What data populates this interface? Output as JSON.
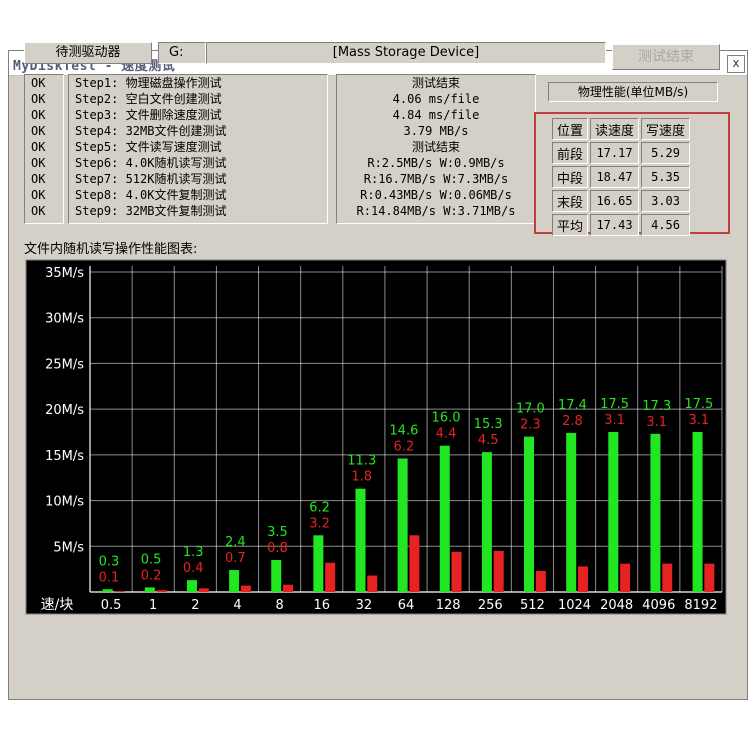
{
  "window": {
    "title": "MyDiskTest - 速度测试",
    "close_glyph": "x"
  },
  "drive": {
    "label": "待测驱动器",
    "letter": "G:",
    "name": "[Mass Storage Device]"
  },
  "done_button": "测试结束",
  "status": [
    "OK",
    "OK",
    "OK",
    "OK",
    "OK",
    "OK",
    "OK",
    "OK",
    "OK"
  ],
  "steps": [
    "Step1: 物理磁盘操作测试",
    "Step2: 空白文件创建测试",
    "Step3: 文件删除速度测试",
    "Step4: 32MB文件创建测试",
    "Step5: 文件读写速度测试",
    "Step6: 4.0K随机读写测试",
    "Step7: 512K随机读写测试",
    "Step8: 4.0K文件复制测试",
    "Step9: 32MB文件复制测试"
  ],
  "results": [
    "测试结束",
    "4.06 ms/file",
    "4.84 ms/file",
    "3.79 MB/s",
    "测试结束",
    "R:2.5MB/s W:0.9MB/s",
    "R:16.7MB/s W:7.3MB/s",
    "R:0.43MB/s W:0.06MB/s",
    "R:14.84MB/s W:3.71MB/s"
  ],
  "perf": {
    "title": "物理性能(单位MB/s)",
    "headers": [
      "位置",
      "读速度",
      "写速度"
    ],
    "rows": [
      [
        "前段",
        "17.17",
        "5.29"
      ],
      [
        "中段",
        "18.47",
        "5.35"
      ],
      [
        "末段",
        "16.65",
        "3.03"
      ],
      [
        "平均",
        "17.43",
        "4.56"
      ]
    ],
    "highlight_color": "#c04040"
  },
  "chart_title": "文件内随机读写操作性能图表:",
  "chart_data": {
    "type": "bar",
    "xlabel": "速/块",
    "categories": [
      "0.5",
      "1",
      "2",
      "4",
      "8",
      "16",
      "32",
      "64",
      "128",
      "256",
      "512",
      "1024",
      "2048",
      "4096",
      "8192"
    ],
    "series": [
      {
        "values": [
          0.3,
          0.5,
          1.3,
          2.4,
          3.5,
          6.2,
          11.3,
          14.6,
          16.0,
          15.3,
          17.0,
          17.4,
          17.5,
          17.3,
          17.5
        ],
        "color": "#22e622"
      },
      {
        "values": [
          0.1,
          0.2,
          0.4,
          0.7,
          0.8,
          3.2,
          1.8,
          6.2,
          4.4,
          4.5,
          2.3,
          2.8,
          3.1,
          3.1,
          3.1
        ],
        "color": "#e62222"
      }
    ],
    "ylim": [
      0,
      35
    ],
    "yticks": [
      "35M/s",
      "30M/s",
      "25M/s",
      "20M/s",
      "15M/s",
      "10M/s",
      "5M/s"
    ],
    "ytick_values": [
      35,
      30,
      25,
      20,
      15,
      10,
      5
    ],
    "grid": true,
    "background": "#000000"
  }
}
